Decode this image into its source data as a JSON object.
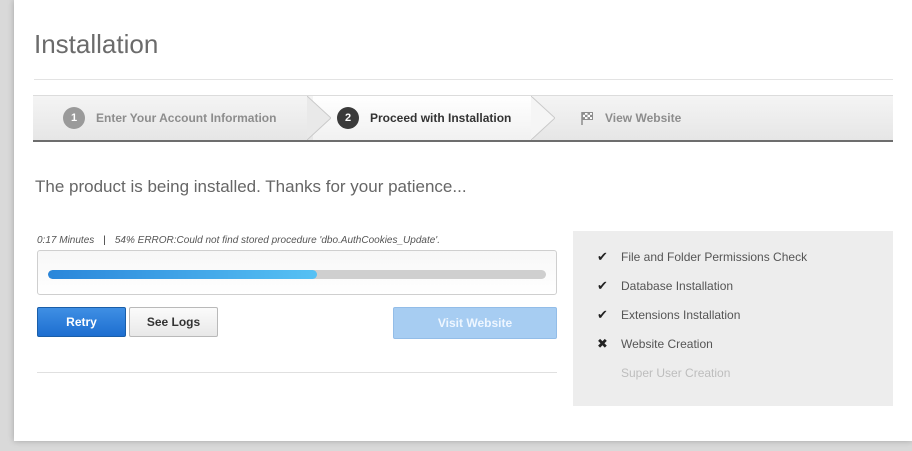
{
  "page": {
    "title": "Installation",
    "message": "The product is being installed. Thanks for your patience..."
  },
  "wizard": {
    "steps": [
      {
        "number": "1",
        "label": "Enter Your Account Information",
        "state": "done"
      },
      {
        "number": "2",
        "label": "Proceed with Installation",
        "state": "active"
      },
      {
        "icon": "flag-icon",
        "label": "View Website",
        "state": "pending"
      }
    ]
  },
  "status": {
    "elapsed": "0:17 Minutes",
    "separator": "|",
    "detail": "54% ERROR:Could not find stored procedure 'dbo.AuthCookies_Update'.",
    "progress_percent": 54
  },
  "buttons": {
    "retry": "Retry",
    "see_logs": "See Logs",
    "visit_website": "Visit Website"
  },
  "checklist": {
    "items": [
      {
        "label": "File and Folder Permissions Check",
        "status": "done",
        "icon": "check-icon",
        "glyph": "✔"
      },
      {
        "label": "Database Installation",
        "status": "done",
        "icon": "check-icon",
        "glyph": "✔"
      },
      {
        "label": "Extensions Installation",
        "status": "done",
        "icon": "check-icon",
        "glyph": "✔"
      },
      {
        "label": "Website Creation",
        "status": "failed",
        "icon": "cross-icon",
        "glyph": "✖"
      },
      {
        "label": "Super User Creation",
        "status": "pending",
        "icon": "",
        "glyph": ""
      }
    ]
  },
  "colors": {
    "primary": "#1d6ed0",
    "progress_start": "#2a86da",
    "progress_end": "#56c1f4",
    "disabled_button": "#a7cdf2"
  }
}
